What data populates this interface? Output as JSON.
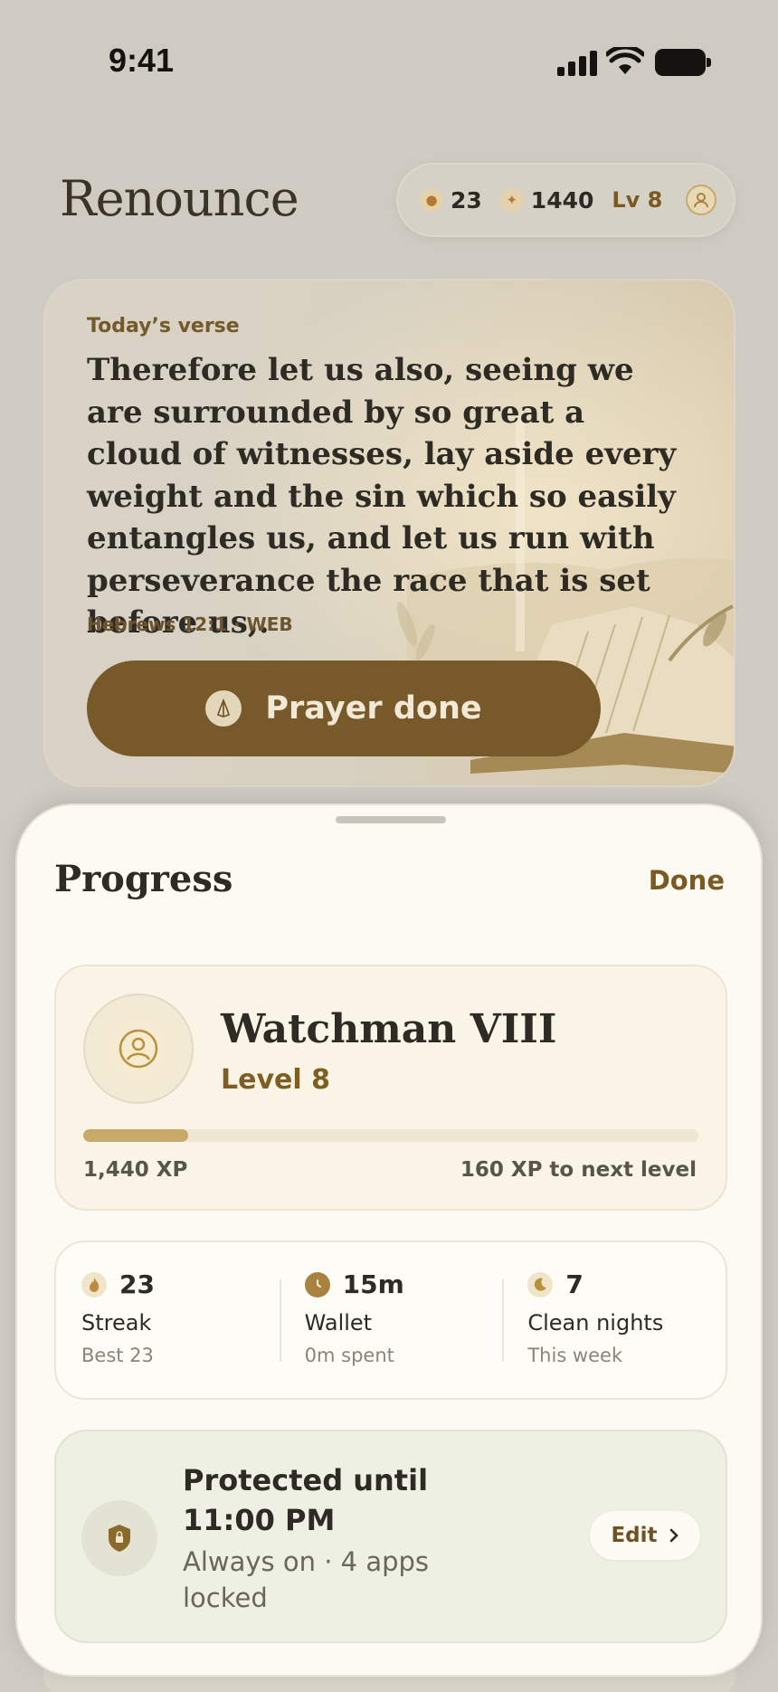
{
  "status_bar": {
    "time": "9:41"
  },
  "header": {
    "logo": "Renounce",
    "stats": {
      "streak": "23",
      "points": "1440",
      "level": "Lv 8"
    }
  },
  "verse": {
    "label": "Today’s verse",
    "text": "Therefore let us also, seeing we are surrounded by so great a cloud of witnesses, lay aside every weight and the sin which so easily entangles us, and let us run with perseverance the race that is set before us,.",
    "reference": "Hebrews 12:1 · WEB",
    "button": "Prayer done"
  },
  "sheet": {
    "title": "Progress",
    "done": "Done",
    "level_card": {
      "name": "Watchman VIII",
      "level": "Level 8",
      "xp": "1,440 XP",
      "to_next": "160 XP to next level",
      "progress_fraction": 0.17
    },
    "stats": [
      {
        "icon": "flame-icon",
        "value": "23",
        "label": "Streak",
        "sub": "Best 23"
      },
      {
        "icon": "clock-icon",
        "value": "15m",
        "label": "Wallet",
        "sub": "0m spent"
      },
      {
        "icon": "moon-icon",
        "value": "7",
        "label": "Clean nights",
        "sub": "This week"
      }
    ],
    "protection": {
      "title": "Protected until 11:00 PM",
      "subtitle": "Always on · 4 apps locked",
      "edit": "Edit"
    }
  },
  "colors": {
    "accent": "#77592a",
    "gold": "#c7a96a",
    "sheet": "#fcfaf2"
  }
}
